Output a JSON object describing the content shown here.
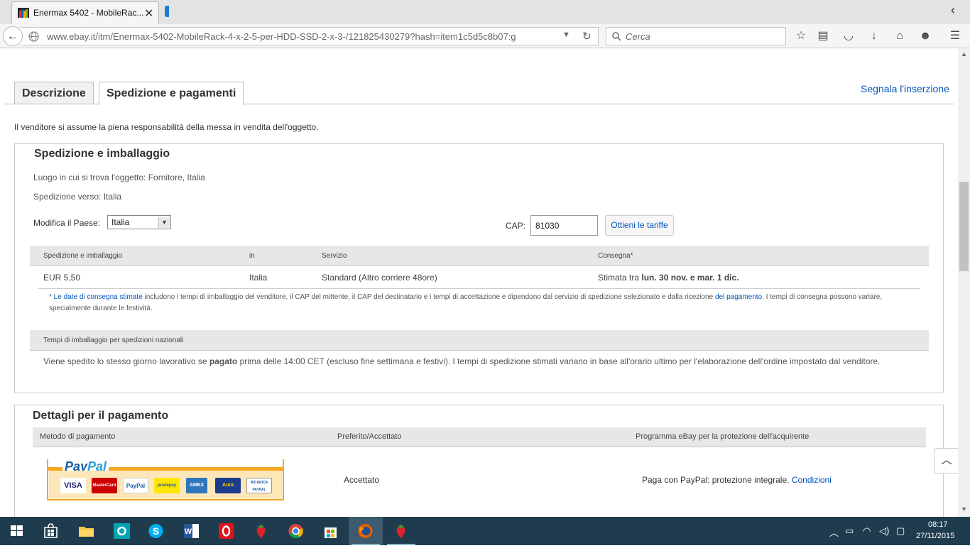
{
  "browser": {
    "tab_title": "Enermax 5402 - MobileRac...",
    "url": "www.ebay.it/itm/Enermax-5402-MobileRack-4-x-2-5-per-HDD-SSD-2-x-3-/121825430279?hash=item1c5d5c8b07:g",
    "search_placeholder": "Cerca"
  },
  "page": {
    "tabs": [
      {
        "label": "Descrizione"
      },
      {
        "label": "Spedizione e pagamenti"
      }
    ],
    "report_link": "Segnala l'inserzione",
    "responsibility_note": "Il venditore si assume la piena responsabilità della messa in vendita dell'oggetto."
  },
  "shipping": {
    "title": "Spedizione e imballaggio",
    "item_location": "Luogo in cui si trova l'oggetto: Fornitore, Italia",
    "ship_to": "Spedizione verso: Italia",
    "country_label": "Modifica il Paese:",
    "country_value": "Italia",
    "cap_label": "CAP:",
    "cap_value": "81030",
    "rates_button": "Ottieni le tariffe",
    "table": {
      "headers": [
        "Spedizione e imballaggio",
        "in",
        "Servizio",
        "Consegna*"
      ],
      "row": {
        "cost": "EUR 5,50",
        "in": "Italia",
        "service": "Standard (Altro corriere 48ore)",
        "delivery_prefix": "Stimata tra ",
        "delivery_dates": "lun. 30 nov. e mar. 1 dic."
      }
    },
    "note": {
      "star": "* ",
      "link1": "Le date di consegna stimate",
      "mid": " includono i tempi di imballaggio del venditore, il CAP del mittente, il CAP del destinatario e i tempi di accettazione e dipendono dal servizio di spedizione selezionato e dalla ricezione ",
      "link2": "del pagamento",
      "end": ". I tempi di consegna possono variare, specialmente durante le festività."
    },
    "handling_header": "Tempi di imballaggio per spedizioni nazionali",
    "handling_text_1": "Viene spedito lo stesso giorno lavorativo se ",
    "handling_text_bold": "pagato",
    "handling_text_2": " prima delle 14:00 CET (escluso fine settimana e festivi). I tempi di spedizione stimati variano in base all'orario ultimo per l'elaborazione dell'ordine impostato dal venditore."
  },
  "payment": {
    "title": "Dettagli per il pagamento",
    "headers": [
      "Metodo di pagamento",
      "Preferito/Accettato",
      "Programma eBay per la protezione dell'acquirente"
    ],
    "logo": {
      "pay": "Pay",
      "pal": "Pal",
      "cards": [
        "VISA",
        "MasterCard",
        "PayPal",
        "postepay",
        "AMEX",
        "Aura",
        "RICARICA PAYPAL"
      ]
    },
    "accepted": "Accettato",
    "protection": "Paga con PayPal: protezione integrale. ",
    "conditions_link": "Condizioni"
  },
  "taskbar": {
    "time": "08:17",
    "date": "27/11/2015"
  },
  "icons": {
    "back": "arrow-left-icon",
    "reload": "reload-icon",
    "star": "bookmark-star-icon",
    "reading_list": "reading-list-icon",
    "pocket": "pocket-icon",
    "download": "download-icon",
    "home": "home-icon",
    "hello": "chat-icon",
    "menu": "hamburger-menu-icon"
  },
  "colors": {
    "link": "#0654ba",
    "taskbar": "#1f3c4f",
    "paypal_orange": "#f5a623",
    "paypal_blue": "#1a5da6"
  }
}
